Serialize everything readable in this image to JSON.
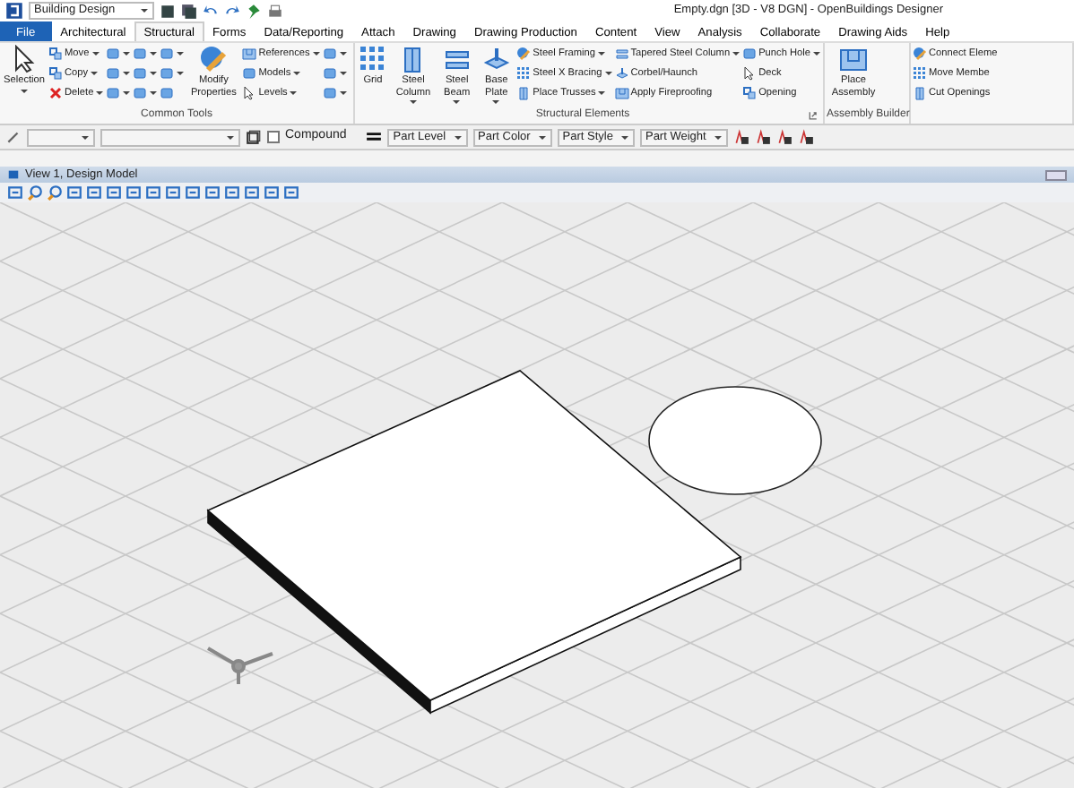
{
  "title_bar": {
    "workspace": "Building Design",
    "title": "Empty.dgn [3D - V8 DGN] - OpenBuildings Designer"
  },
  "tabs": [
    {
      "label": "File",
      "selected": false,
      "kind": "file"
    },
    {
      "label": "Architectural",
      "selected": false
    },
    {
      "label": "Structural",
      "selected": true
    },
    {
      "label": "Forms",
      "selected": false
    },
    {
      "label": "Data/Reporting",
      "selected": false
    },
    {
      "label": "Attach",
      "selected": false
    },
    {
      "label": "Drawing",
      "selected": false
    },
    {
      "label": "Drawing Production",
      "selected": false
    },
    {
      "label": "Content",
      "selected": false
    },
    {
      "label": "View",
      "selected": false
    },
    {
      "label": "Analysis",
      "selected": false
    },
    {
      "label": "Collaborate",
      "selected": false
    },
    {
      "label": "Drawing Aids",
      "selected": false
    },
    {
      "label": "Help",
      "selected": false
    }
  ],
  "ribbon_groups": [
    {
      "label": "Common Tools",
      "columns": [
        {
          "kind": "large",
          "label": "Selection",
          "dropdown": true
        },
        {
          "kind": "small",
          "items": [
            {
              "label": "Move",
              "dropdown": true
            },
            {
              "label": "Copy",
              "dropdown": true
            },
            {
              "label": "Delete",
              "dropdown": true
            }
          ]
        },
        {
          "kind": "small",
          "items": [
            {
              "dropdown": true
            },
            {
              "dropdown": true
            },
            {
              "dropdown": true
            }
          ]
        },
        {
          "kind": "small",
          "items": [
            {
              "dropdown": true
            },
            {
              "dropdown": true
            },
            {
              "dropdown": true
            }
          ]
        },
        {
          "kind": "small",
          "items": [
            {
              "dropdown": true
            },
            {
              "dropdown": true
            },
            {
              "dropdown": false
            }
          ]
        },
        {
          "kind": "large",
          "label": "Modify Properties",
          "dropdown": false
        },
        {
          "kind": "small",
          "items": [
            {
              "label": "References",
              "dropdown": true
            },
            {
              "label": "Models",
              "dropdown": true
            },
            {
              "label": "Levels",
              "dropdown": true
            }
          ]
        },
        {
          "kind": "small",
          "items": [
            {
              "dropdown": true
            },
            {
              "dropdown": true
            },
            {
              "dropdown": true
            }
          ]
        }
      ]
    },
    {
      "label": "Structural Elements",
      "launcher": true,
      "columns": [
        {
          "kind": "large",
          "label": "Grid",
          "dropdown": false
        },
        {
          "kind": "large",
          "label": "Steel Column",
          "dropdown": true
        },
        {
          "kind": "large",
          "label": "Steel Beam",
          "dropdown": true
        },
        {
          "kind": "large",
          "label": "Base Plate",
          "dropdown": true
        },
        {
          "kind": "small",
          "items": [
            {
              "label": "Steel Framing",
              "dropdown": true
            },
            {
              "label": "Steel X Bracing",
              "dropdown": true
            },
            {
              "label": "Place Trusses",
              "dropdown": true
            }
          ]
        },
        {
          "kind": "small",
          "items": [
            {
              "label": "Tapered Steel Column",
              "dropdown": true
            },
            {
              "label": "Corbel/Haunch",
              "dropdown": false
            },
            {
              "label": "Apply Fireproofing",
              "dropdown": false
            }
          ]
        },
        {
          "kind": "small",
          "items": [
            {
              "label": "Punch Hole",
              "dropdown": true
            },
            {
              "label": "Deck",
              "dropdown": false
            },
            {
              "label": "Opening",
              "dropdown": false
            }
          ]
        }
      ]
    },
    {
      "label": "Assembly Builder",
      "columns": [
        {
          "kind": "large",
          "label": "Place Assembly",
          "dropdown": false
        }
      ]
    },
    {
      "columns": [
        {
          "kind": "small",
          "items": [
            {
              "label": "Connect Eleme",
              "dropdown": false
            },
            {
              "label": "Move Membe",
              "dropdown": false
            },
            {
              "label": "Cut Openings",
              "dropdown": false
            }
          ]
        }
      ]
    }
  ],
  "attribute_bar": {
    "compound": {
      "label": "Compound",
      "checked": false
    },
    "dropdowns": [
      {
        "label": "Part Level"
      },
      {
        "label": "Part Color"
      },
      {
        "label": "Part Style"
      },
      {
        "label": "Part Weight"
      }
    ]
  },
  "view": {
    "title": "View 1, Design Model"
  }
}
